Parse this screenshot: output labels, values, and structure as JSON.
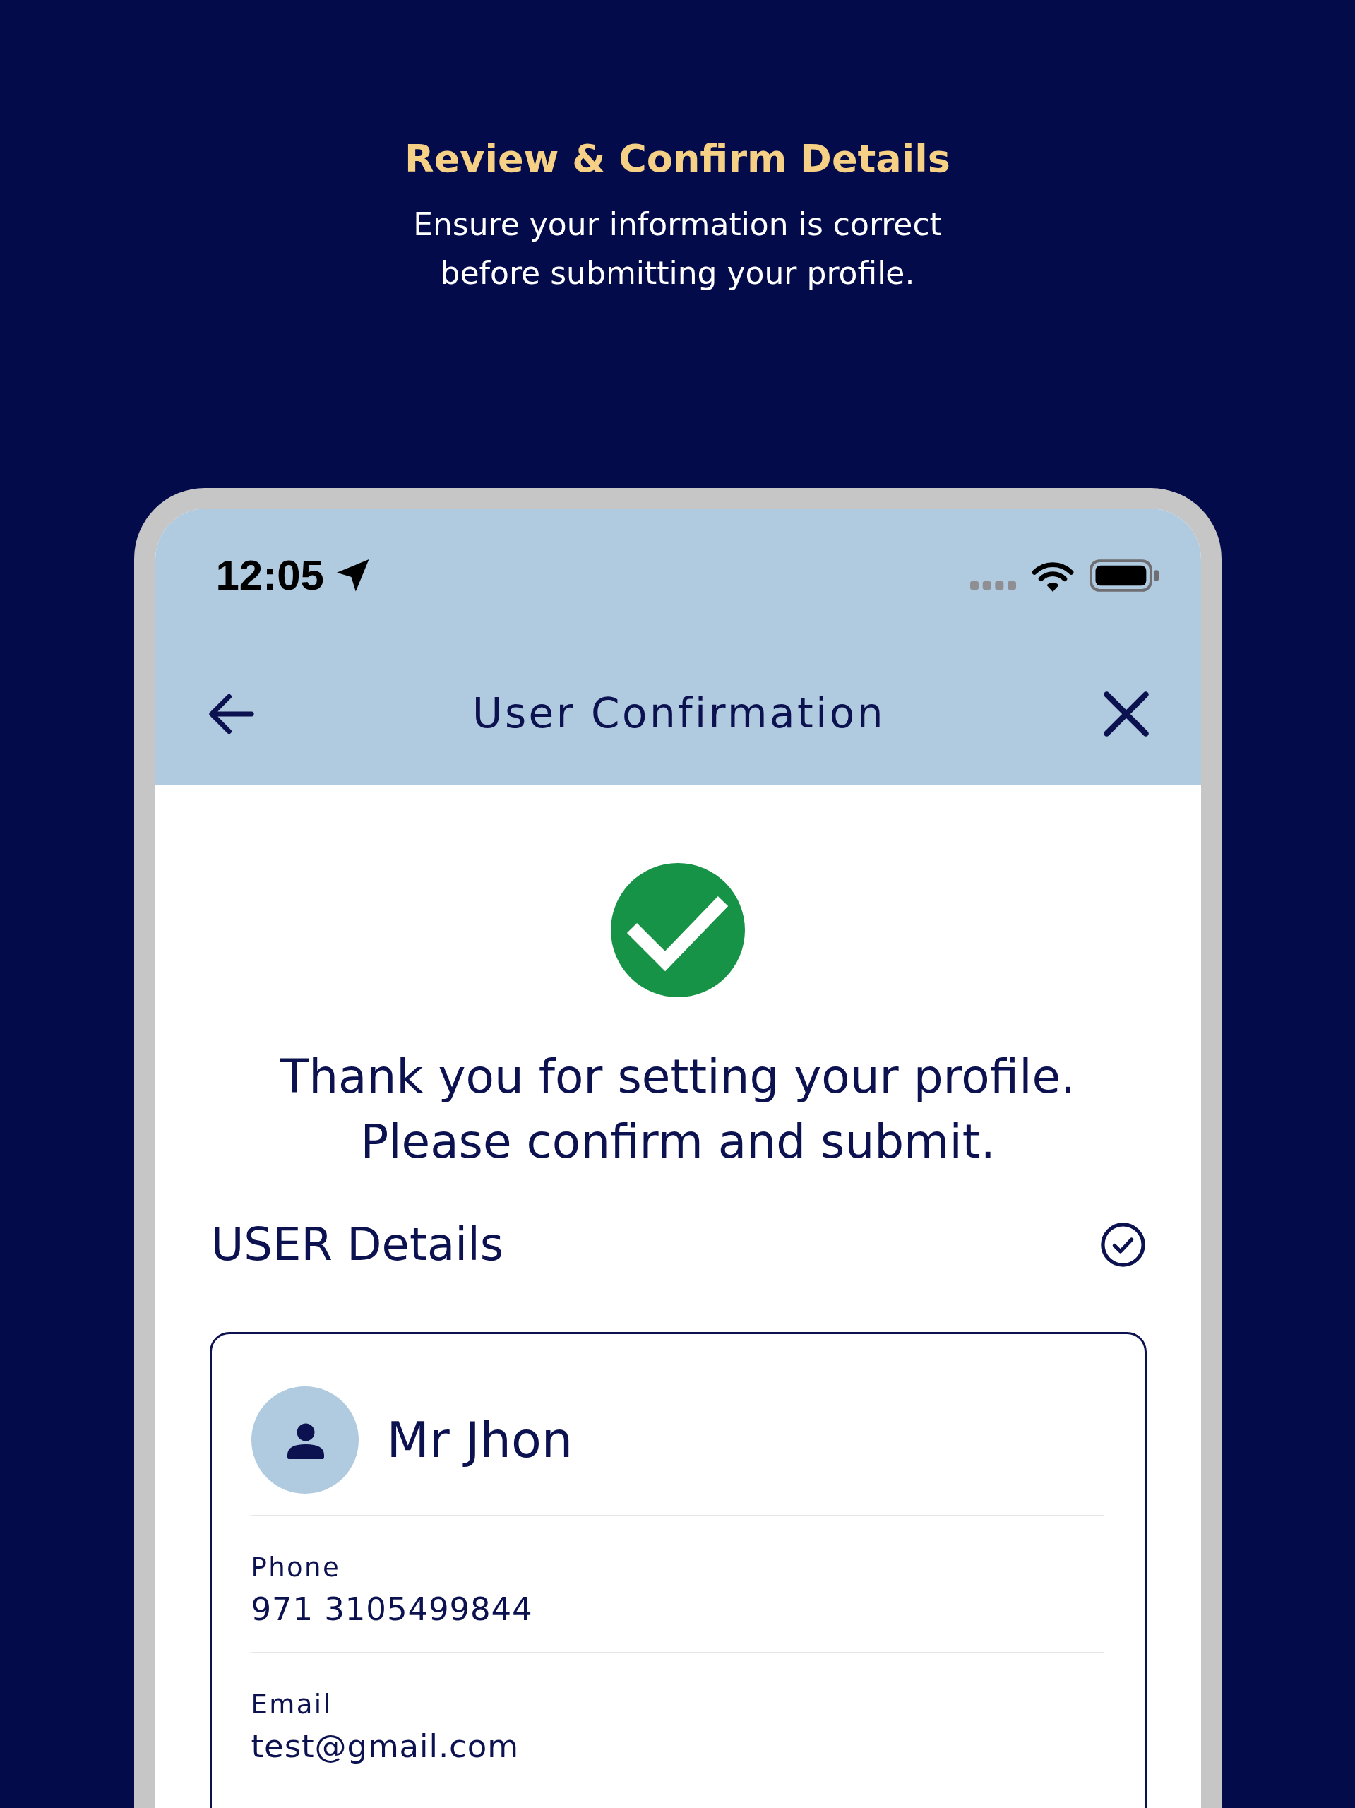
{
  "promo": {
    "title": "Review & Confirm Details",
    "subtitle": "Ensure your information is correct before submitting your profile."
  },
  "status_bar": {
    "time": "12:05"
  },
  "nav": {
    "title": "User Confirmation"
  },
  "confirmation": {
    "message": "Thank you for setting your profile. Please confirm and submit."
  },
  "section": {
    "title": "USER Details",
    "completed": true
  },
  "card": {
    "name": "Mr Jhon",
    "fields": [
      {
        "label": "Phone",
        "value": "971 3105499844"
      },
      {
        "label": "Email",
        "value": "test@gmail.com"
      }
    ]
  }
}
